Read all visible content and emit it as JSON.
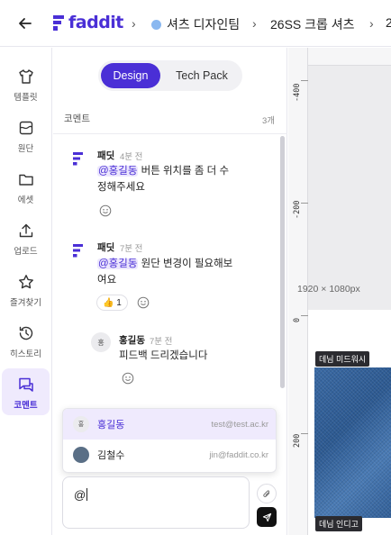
{
  "header": {
    "logo_text": "faddit",
    "breadcrumbs": [
      {
        "label": "셔츠 디자인팀",
        "dot_color": "#8ab8f0"
      },
      {
        "label": "26SS 크롭 셔츠"
      },
      {
        "label": "2"
      }
    ]
  },
  "nav": {
    "items": [
      {
        "label": "템플릿",
        "icon": "shirt-icon"
      },
      {
        "label": "원단",
        "icon": "fabric-icon"
      },
      {
        "label": "에셋",
        "icon": "folder-icon"
      },
      {
        "label": "업로드",
        "icon": "upload-icon"
      },
      {
        "label": "즐겨찾기",
        "icon": "star-icon"
      },
      {
        "label": "히스토리",
        "icon": "history-icon"
      },
      {
        "label": "코멘트",
        "icon": "comment-icon",
        "active": true
      }
    ]
  },
  "panel": {
    "tabs": {
      "design": "Design",
      "techpack": "Tech Pack"
    },
    "title": "코멘트",
    "count": "3개",
    "comments": [
      {
        "author": "패딧",
        "time": "4분 전",
        "mention": "@홍길동",
        "text_line1": " 버튼 위치를 좀 더 수",
        "text_line2": "정해주세요"
      },
      {
        "author": "패딧",
        "time": "7분 전",
        "mention": "@홍길동",
        "text_line1": " 원단 변경이 필요해보",
        "text_line2": "여요",
        "reaction_emoji": "👍",
        "reaction_count": "1"
      }
    ],
    "reply": {
      "avatar_text": "홍",
      "author": "홍길동",
      "time": "7분 전",
      "text": "피드백 드리겠습니다"
    },
    "mention_suggestions": [
      {
        "avatar_text": "홍",
        "name": "홍길동",
        "email": "test@test.ac.kr",
        "selected": true
      },
      {
        "avatar_text": "",
        "name": "김철수",
        "email": "jin@faddit.co.kr",
        "selected": false
      }
    ],
    "composer_value": "@"
  },
  "canvas": {
    "ruler_labels": [
      "-400",
      "-200",
      "0",
      "200"
    ],
    "artboard_size": "1920 × 1080px",
    "fabric_tags": [
      "데님 미드워시",
      "데님 인디고"
    ]
  },
  "colors": {
    "accent": "#4a2fd6",
    "accent_soft": "#efeafd"
  }
}
